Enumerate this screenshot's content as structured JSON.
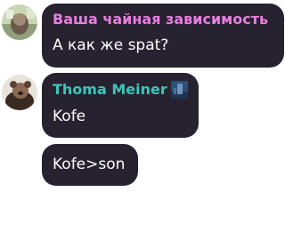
{
  "messages": [
    {
      "sender": "Ваша чайная зависимость",
      "sender_color": "#e87de0",
      "text": "А как же spat?",
      "avatar_icon": "avatar-photo"
    },
    {
      "sender": "Thoma Meiner",
      "sender_color": "#3cc6b8",
      "text": "Kofe",
      "avatar_icon": "avatar-photo",
      "badge_icon": "badge-icon"
    },
    {
      "text": "Kofe>son"
    }
  ],
  "colors": {
    "bubble_bg": "#262230",
    "text": "#ffffff"
  }
}
